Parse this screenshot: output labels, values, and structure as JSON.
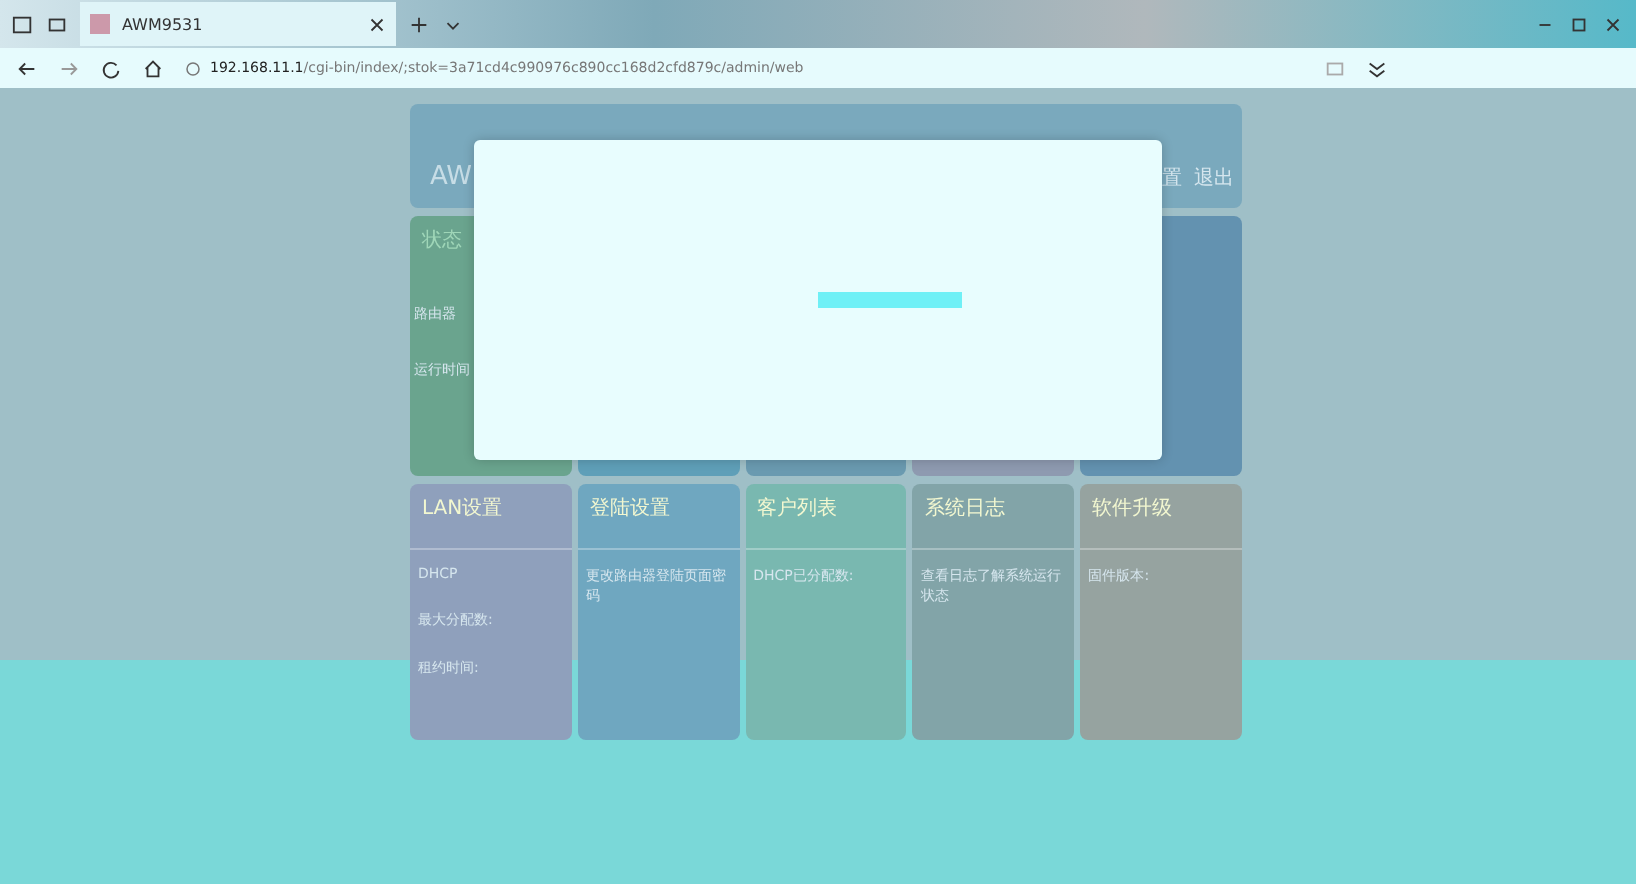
{
  "browser": {
    "tab_title": "AWM9531",
    "url_host": "192.168.11.1",
    "url_path": "/cgi-bin/index/;stok=3a71cd4c990976c890cc168d2cfd879c/admin/web"
  },
  "header": {
    "title": "AW",
    "links": [
      "置",
      "退出"
    ]
  },
  "status_card": {
    "title": "状态",
    "labels": [
      "路由器",
      "运行时间"
    ]
  },
  "cards": [
    {
      "title": "LAN设置",
      "lines": [
        "DHCP",
        "最大分配数:",
        "租约时间:"
      ]
    },
    {
      "title": "登陆设置",
      "lines": [
        "更改路由器登陆页面密码"
      ]
    },
    {
      "title": "客户列表",
      "lines": [
        "DHCP已分配数:"
      ]
    },
    {
      "title": "系统日志",
      "lines": [
        "查看日志了解系统运行状态"
      ]
    },
    {
      "title": "软件升级",
      "lines": [
        "固件版本:"
      ]
    }
  ]
}
